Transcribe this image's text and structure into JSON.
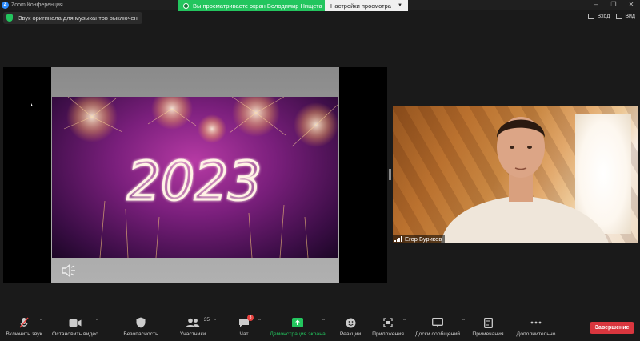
{
  "window": {
    "title": "Zoom Конференция",
    "logo_letter": "Z"
  },
  "banner": {
    "sharing_text": "Вы просматриваете экран Володимир Нищета",
    "view_options": "Настройки просмотра"
  },
  "notice": {
    "text": "Звук оригинала для музыкантов выключен"
  },
  "top_right": {
    "enter": "Вход",
    "view": "Вид"
  },
  "slide": {
    "year_text": "2023"
  },
  "participant": {
    "name": "Егор Буриков"
  },
  "toolbar": {
    "mic": "Включить звук",
    "video": "Остановить видео",
    "security": "Безопасность",
    "participants": "Участники",
    "participants_count": "35",
    "chat": "Чат",
    "chat_badge": "3",
    "share": "Демонстрация экрана",
    "reactions": "Реакции",
    "apps": "Приложения",
    "boards": "Доски сообщений",
    "notes": "Примечания",
    "more": "Дополнительно",
    "end": "Завершение"
  },
  "colors": {
    "accent_green": "#23c55e",
    "end_red": "#d9363e",
    "zoom_blue": "#2d8cff"
  }
}
